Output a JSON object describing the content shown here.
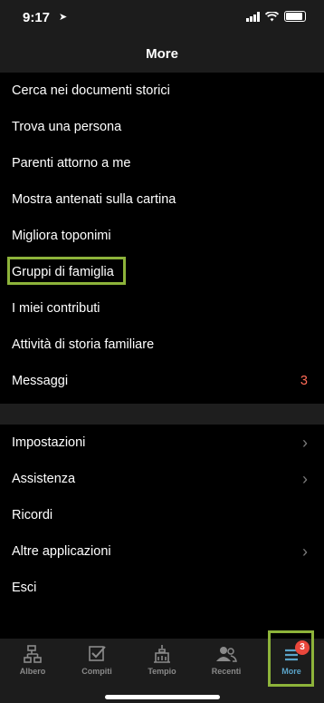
{
  "status": {
    "time": "9:17"
  },
  "nav": {
    "title": "More"
  },
  "menu": [
    {
      "label": "Cerca nei documenti storici"
    },
    {
      "label": "Trova una persona"
    },
    {
      "label": "Parenti attorno a me"
    },
    {
      "label": "Mostra antenati sulla cartina"
    },
    {
      "label": "Migliora toponimi"
    },
    {
      "label": "Gruppi di famiglia"
    },
    {
      "label": "I miei contributi"
    },
    {
      "label": "Attività di storia familiare"
    },
    {
      "label": "Messaggi",
      "count": "3"
    }
  ],
  "settings": [
    {
      "label": "Impostazioni"
    },
    {
      "label": "Assistenza"
    },
    {
      "label": "Ricordi"
    },
    {
      "label": "Altre applicazioni"
    },
    {
      "label": "Esci"
    }
  ],
  "tabs": [
    {
      "label": "Albero",
      "icon": "tree-icon"
    },
    {
      "label": "Compiti",
      "icon": "checklist-icon"
    },
    {
      "label": "Tempio",
      "icon": "temple-icon"
    },
    {
      "label": "Recenti",
      "icon": "people-icon"
    },
    {
      "label": "More",
      "icon": "menu-icon",
      "badge": "3"
    }
  ],
  "colors": {
    "accent": "#5ba4c9",
    "highlight": "#8db33a",
    "badge": "#e9473c",
    "count": "#ff6b57"
  }
}
